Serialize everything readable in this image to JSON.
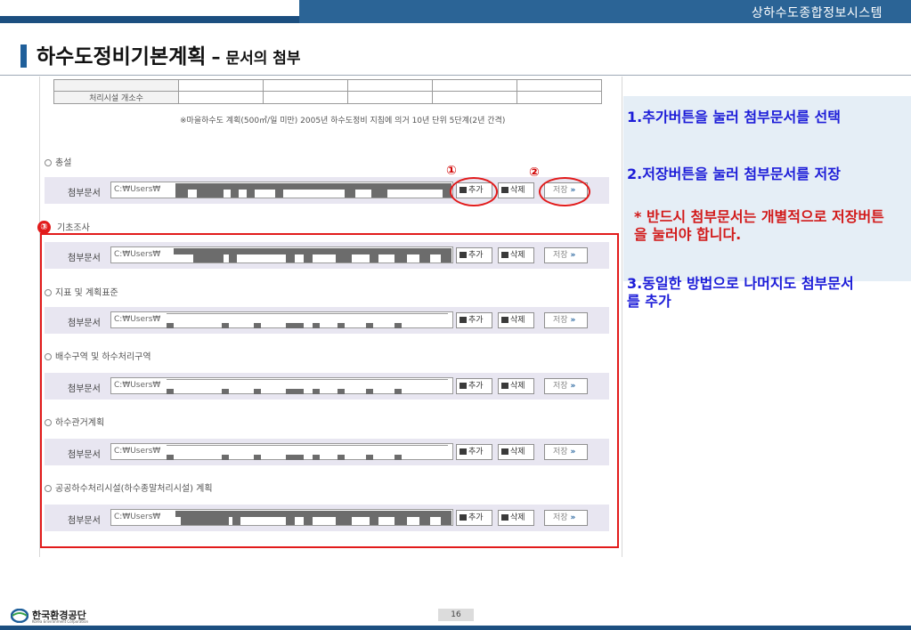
{
  "header": {
    "system_title": "상하수도종합정보시스템"
  },
  "slide": {
    "title": "하수도정비기본계획",
    "separator": "–",
    "subtitle": "문서의 첨부"
  },
  "screenshot": {
    "table_row_label": "처리시설 개소수",
    "note": "※마을하수도 계획(500㎥/일 미만) 2005년 하수도정비 지침에 의거 10년 단위 5단계(2년 간격)",
    "sections": [
      {
        "label": "총설",
        "marker": ""
      },
      {
        "label": "기초조사",
        "marker": "③"
      },
      {
        "label": "지표 및 계획표준",
        "marker": ""
      },
      {
        "label": "배수구역 및 하수처리구역",
        "marker": ""
      },
      {
        "label": "하수관거계획",
        "marker": ""
      },
      {
        "label": "공공하수처리시설(하수종말처리시설) 계획",
        "marker": ""
      }
    ],
    "attach_label": "첨부문서",
    "file_prefix": "C:₩Users₩",
    "add_button": "추가",
    "delete_button": "삭제",
    "save_button": "저장",
    "save_arrows": "»",
    "marker_1": "①",
    "marker_2": "②"
  },
  "instructions": {
    "step1": "1.추가버튼을 눌러 첨부문서를 선택",
    "step2": "2.저장버튼을 눌러 첨부문서를 저장",
    "step2_note": "* 반드시 첨부문서는 개별적으로 저장버튼을 눌러야 합니다.",
    "step3": "3.동일한 방법으로 나머지도 첨부문서를 추가"
  },
  "footer": {
    "org_name": "한국환경공단",
    "org_english": "Korea Environment Corporation",
    "page_number": "16"
  },
  "colors": {
    "accent": "#2b6496",
    "highlight": "#e21b1b",
    "instruction_blue": "#1c1cd8"
  }
}
